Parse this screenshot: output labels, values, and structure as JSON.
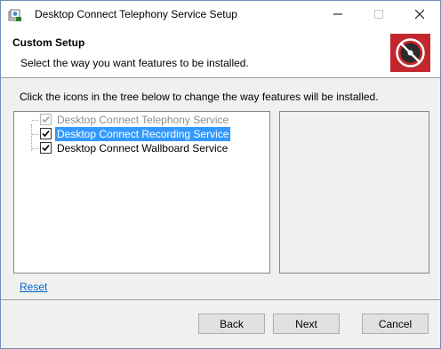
{
  "window": {
    "title": "Desktop Connect Telephony Service Setup",
    "app_icon": "installer-icon",
    "controls": {
      "minimize": "minimize-icon",
      "maximize": "maximize-icon",
      "close": "close-icon"
    }
  },
  "header": {
    "title": "Custom Setup",
    "description": "Select the way you want features to be installed.",
    "logo": "disc-logo-icon",
    "logo_color": "#c1272d"
  },
  "body": {
    "instruction": "Click the icons in the tree below to change the way features will be installed.",
    "features": [
      {
        "label": "Desktop Connect Telephony Service",
        "checked": true,
        "disabled": true,
        "selected": false
      },
      {
        "label": "Desktop Connect Recording Service",
        "checked": true,
        "disabled": false,
        "selected": true
      },
      {
        "label": "Desktop Connect Wallboard Service",
        "checked": true,
        "disabled": false,
        "selected": false
      }
    ],
    "reset_label": "Reset"
  },
  "buttons": {
    "back": "Back",
    "next": "Next",
    "cancel": "Cancel"
  },
  "colors": {
    "selection": "#3399ff",
    "link": "#0066cc"
  }
}
